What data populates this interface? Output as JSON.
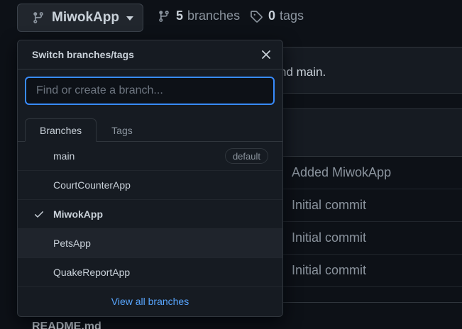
{
  "header": {
    "current_branch": "MiwokApp",
    "branches_count": "5",
    "branches_label": "branches",
    "tags_count": "0",
    "tags_label": "tags"
  },
  "background": {
    "top_text": "nd main.",
    "commits": [
      "Added MiwokApp",
      "Initial commit",
      "Initial commit",
      "Initial commit"
    ],
    "readme": "README.md"
  },
  "dropdown": {
    "title": "Switch branches/tags",
    "search_placeholder": "Find or create a branch...",
    "tabs": [
      "Branches",
      "Tags"
    ],
    "branches": [
      {
        "name": "main",
        "badge": "default"
      },
      {
        "name": "CourtCounterApp"
      },
      {
        "name": "MiwokApp"
      },
      {
        "name": "PetsApp"
      },
      {
        "name": "QuakeReportApp"
      }
    ],
    "footer_link": "View all branches"
  }
}
